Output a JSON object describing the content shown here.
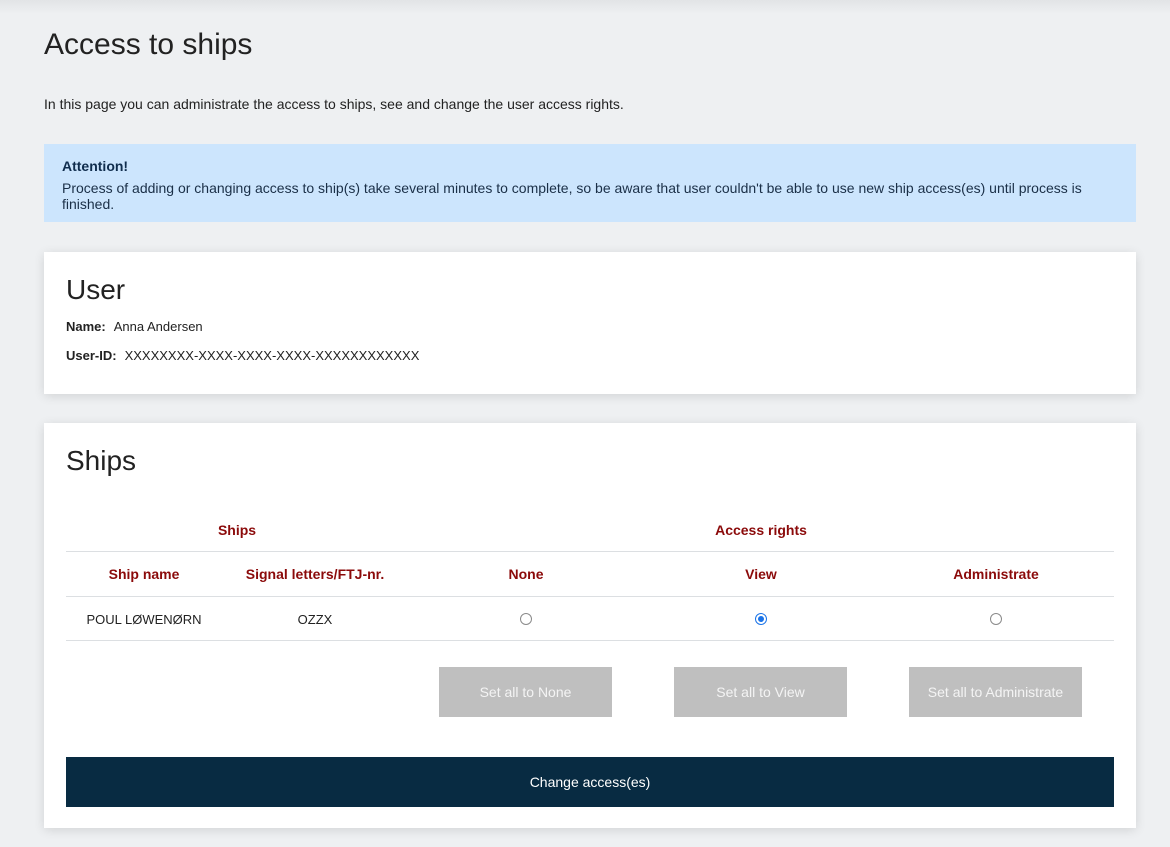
{
  "page": {
    "title": "Access to ships",
    "intro": "In this page you can administrate the access to ships, see and change the user access rights."
  },
  "alert": {
    "title": "Attention!",
    "text": "Process of adding or changing access to ship(s) take several minutes to complete, so be aware that user couldn't be able to use new ship access(es) until process is finished."
  },
  "user": {
    "title": "User",
    "name_label": "Name:",
    "name": "Anna Andersen",
    "id_label": "User-ID:",
    "id": "XXXXXXXX-XXXX-XXXX-XXXX-XXXXXXXXXXXX"
  },
  "ships": {
    "title": "Ships",
    "group_headers": {
      "ships": "Ships",
      "access_rights": "Access rights"
    },
    "columns": {
      "ship_name": "Ship name",
      "signal": "Signal letters/FTJ-nr.",
      "none": "None",
      "view": "View",
      "administrate": "Administrate"
    },
    "rows": [
      {
        "ship_name": "POUL LØWENØRN",
        "signal": "OZZX",
        "access": "view"
      }
    ],
    "buttons": {
      "set_none": "Set all to None",
      "set_view": "Set all to View",
      "set_admin": "Set all to Administrate",
      "submit": "Change access(es)"
    }
  },
  "colors": {
    "accent_header": "#8b0a0a",
    "alert_bg": "#cce5fd",
    "submit_bg": "#082b42",
    "disabled_button_bg": "#bfbfbf",
    "radio_selected": "#1a73e8"
  }
}
